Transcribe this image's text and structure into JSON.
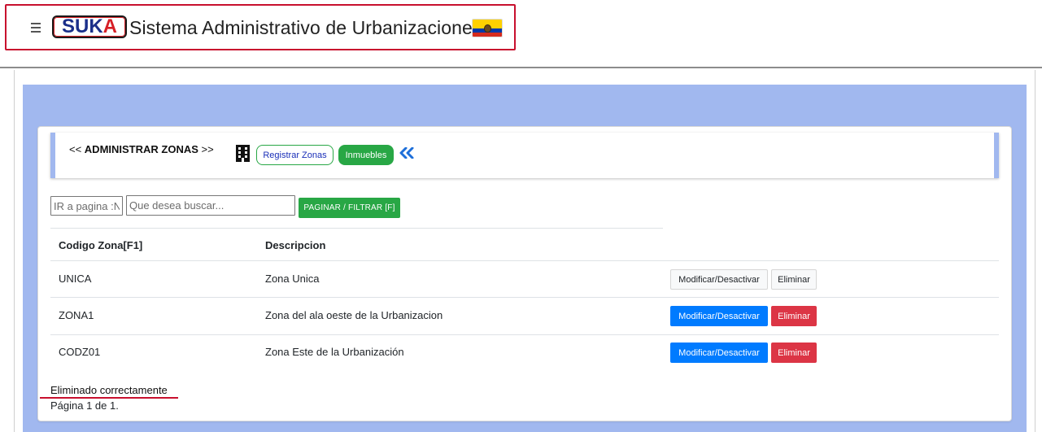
{
  "header": {
    "logo_text_main": "SUK",
    "logo_text_accent": "A",
    "title": "Sistema Administrativo de Urbanizaciones",
    "menu_icon": "hamburger-icon",
    "flag_icon": "ecuador-flag-icon",
    "brand_border_color": "#c8102e"
  },
  "panel": {
    "heading_prefix": "<< ",
    "heading": "ADMINISTRAR ZONAS",
    "heading_suffix": " >>",
    "building_icon": "building-icon",
    "register_label": "Registrar Zonas",
    "inmuebles_label": "Inmuebles",
    "back_icon": "double-chevron-left-icon",
    "accent_color": "#a1b8ef"
  },
  "filters": {
    "page_placeholder": "IR a pagina :N",
    "page_value": "",
    "search_placeholder": "Que desea buscar...",
    "search_value": "",
    "submit_label": "PAGINAR / FILTRAR [F]"
  },
  "table": {
    "columns": [
      "Codigo Zona[F1]",
      "Descripcion"
    ],
    "rows": [
      {
        "code": "UNICA",
        "description": "Zona Unica",
        "modify_label": "Modificar/Desactivar",
        "delete_label": "Eliminar",
        "style": "light"
      },
      {
        "code": "ZONA1",
        "description": "Zona del ala oeste de la Urbanizacion",
        "modify_label": "Modificar/Desactivar",
        "delete_label": "Eliminar",
        "style": "solid"
      },
      {
        "code": "CODZ01",
        "description": "Zona Este de la Urbanización",
        "modify_label": "Modificar/Desactivar",
        "delete_label": "Eliminar",
        "style": "solid"
      }
    ]
  },
  "footer": {
    "status_message": "Eliminado correctamente",
    "pagination": "Página 1 de 1."
  },
  "colors": {
    "primary": "#007bff",
    "success": "#28a745",
    "danger": "#dc3545",
    "content_background": "#a1b8ef"
  }
}
